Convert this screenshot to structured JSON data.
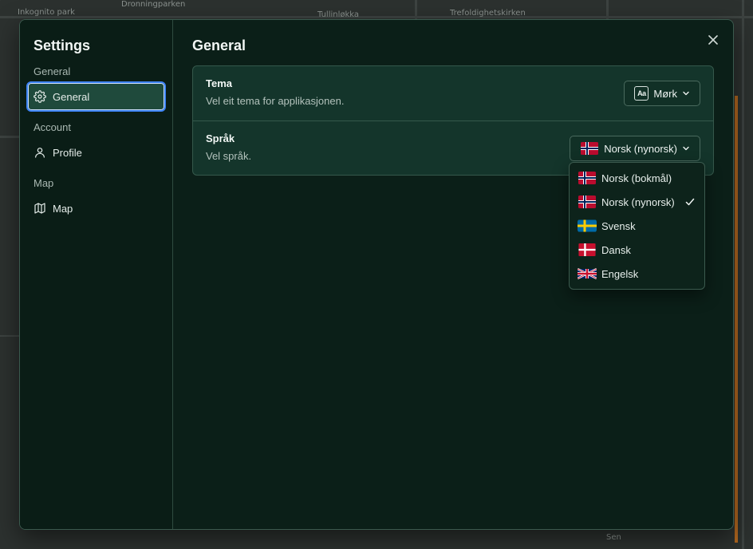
{
  "map": {
    "labels": [
      "Inkognito park",
      "Dronningparken",
      "Tullinløkka",
      "Trefoldighetskirken",
      "Sen"
    ]
  },
  "sidebar": {
    "title": "Settings",
    "groups": [
      {
        "label": "General",
        "item": "General",
        "icon": "gear-icon"
      },
      {
        "label": "Account",
        "item": "Profile",
        "icon": "user-icon"
      },
      {
        "label": "Map",
        "item": "Map",
        "icon": "map-icon"
      }
    ]
  },
  "main": {
    "title": "General",
    "rows": [
      {
        "title": "Tema",
        "desc": "Vel eit tema for applikasjonen.",
        "value": "Mørk",
        "icon": "font-theme-icon"
      },
      {
        "title": "Språk",
        "desc": "Vel språk.",
        "value": "Norsk (nynorsk)",
        "icon": "flag-no-icon"
      }
    ]
  },
  "dropdown": {
    "options": [
      {
        "label": "Norsk (bokmål)",
        "flag": "no",
        "selected": false
      },
      {
        "label": "Norsk (nynorsk)",
        "flag": "no",
        "selected": true
      },
      {
        "label": "Svensk",
        "flag": "se",
        "selected": false
      },
      {
        "label": "Dansk",
        "flag": "dk",
        "selected": false
      },
      {
        "label": "Engelsk",
        "flag": "gb",
        "selected": false
      }
    ]
  },
  "colors": {
    "accent": "#3b82f6",
    "active_bg": "#1f4a3c",
    "dialog_bg": "#0b1f18"
  }
}
